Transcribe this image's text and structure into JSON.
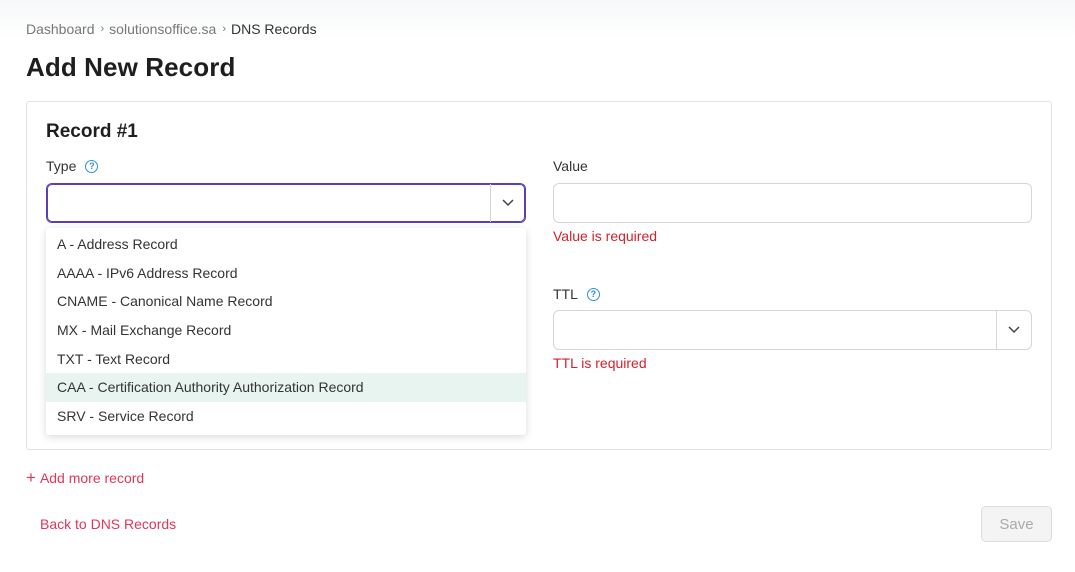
{
  "breadcrumb": {
    "items": [
      "Dashboard",
      "solutionsoffice.sa",
      "DNS Records"
    ]
  },
  "page_title": "Add New Record",
  "record": {
    "title": "Record #1",
    "type": {
      "label": "Type",
      "value": "",
      "options": [
        "A - Address Record",
        "AAAA - IPv6 Address Record",
        "CNAME - Canonical Name Record",
        "MX - Mail Exchange Record",
        "TXT - Text Record",
        "CAA - Certification Authority Authorization Record",
        "SRV - Service Record"
      ],
      "highlighted_option": "CAA - Certification Authority Authorization Record"
    },
    "value": {
      "label": "Value",
      "value": "",
      "error": "Value is required"
    },
    "ttl": {
      "label": "TTL",
      "value": "",
      "error": "TTL is required"
    }
  },
  "actions": {
    "add_more": "Add more record",
    "back": "Back to DNS Records",
    "save": "Save"
  },
  "colors": {
    "accent_link": "#e0365a",
    "error": "#d6202a",
    "focus_border": "#5b3fb5",
    "highlight_option": "#e8f4ef",
    "help_icon": "#2f8fd6"
  },
  "icons": [
    "chevron-right-icon",
    "help-icon",
    "chevron-down-icon",
    "plus-icon"
  ]
}
